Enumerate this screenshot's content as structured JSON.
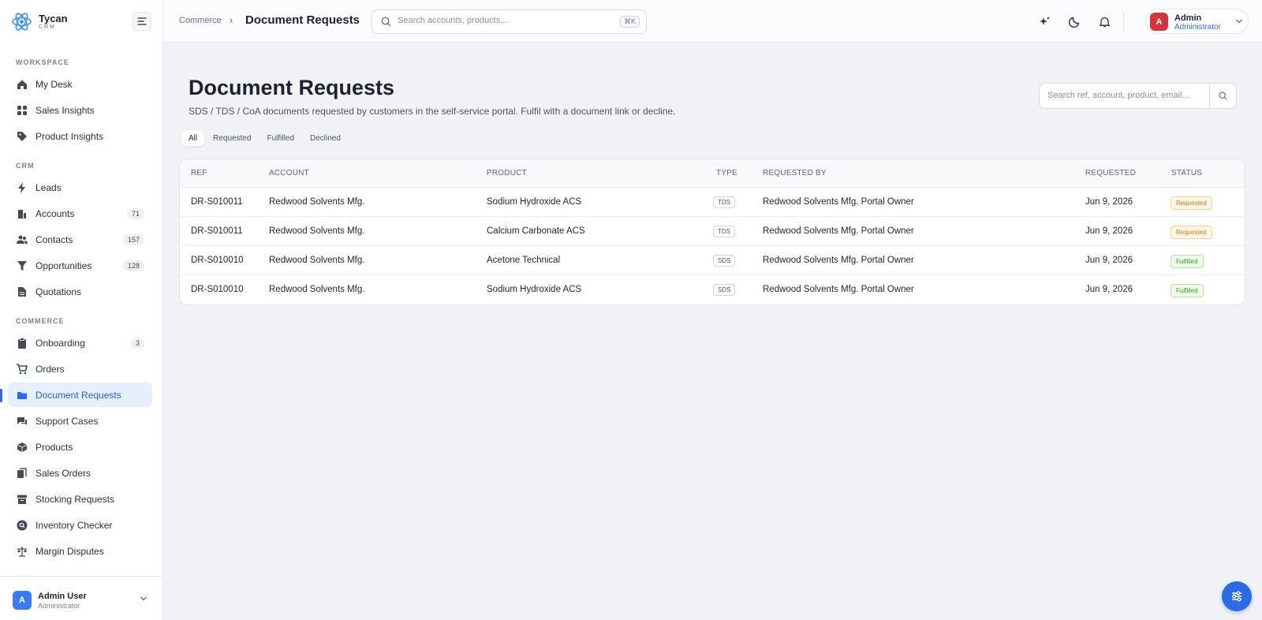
{
  "brand": {
    "name": "Tycan",
    "sub": "CRM"
  },
  "sidebar": {
    "sections": {
      "workspace": "WORKSPACE",
      "crm": "CRM",
      "commerce": "COMMERCE"
    },
    "items": [
      {
        "label": "My Desk",
        "icon": "home-icon"
      },
      {
        "label": "Sales Insights",
        "icon": "grid-icon"
      },
      {
        "label": "Product Insights",
        "icon": "tag-icon"
      },
      {
        "label": "Leads",
        "icon": "bolt-icon"
      },
      {
        "label": "Accounts",
        "icon": "building-icon",
        "count": "71"
      },
      {
        "label": "Contacts",
        "icon": "users-icon",
        "count": "157"
      },
      {
        "label": "Opportunities",
        "icon": "funnel-icon",
        "count": "128"
      },
      {
        "label": "Quotations",
        "icon": "file-icon"
      },
      {
        "label": "Onboarding",
        "icon": "clipboard-icon",
        "count": "3"
      },
      {
        "label": "Orders",
        "icon": "cart-icon"
      },
      {
        "label": "Document Requests",
        "icon": "folder-icon"
      },
      {
        "label": "Support Cases",
        "icon": "chat-icon"
      },
      {
        "label": "Products",
        "icon": "box-icon"
      },
      {
        "label": "Sales Orders",
        "icon": "copy-icon"
      },
      {
        "label": "Stocking Requests",
        "icon": "archive-icon"
      },
      {
        "label": "Inventory Checker",
        "icon": "search-circle-icon"
      },
      {
        "label": "Margin Disputes",
        "icon": "scale-icon"
      }
    ],
    "footer": {
      "avatar": "A",
      "name": "Admin User",
      "role": "Administrator"
    }
  },
  "topbar": {
    "breadcrumb": "Commerce",
    "separator": "›",
    "title": "Document Requests",
    "search_placeholder": "Search accounts, products...",
    "shortcut": "⌘K",
    "user": {
      "avatar": "A",
      "name": "Admin",
      "role": "Administrator"
    }
  },
  "main": {
    "title": "Document Requests",
    "subtitle": "SDS / TDS / CoA documents requested by customers in the self-service portal. Fulfil with a document link or decline.",
    "search_placeholder": "Search ref, account, product, email...",
    "tabs": [
      "All",
      "Requested",
      "Fulfilled",
      "Declined"
    ],
    "columns": [
      "REF",
      "ACCOUNT",
      "PRODUCT",
      "TYPE",
      "REQUESTED BY",
      "REQUESTED",
      "STATUS"
    ],
    "rows": [
      {
        "ref": "DR-S010011",
        "account": "Redwood Solvents Mfg.",
        "product": "Sodium Hydroxide ACS",
        "type": "TDS",
        "requested_by": "Redwood Solvents Mfg. Portal Owner",
        "requested": "Jun 9, 2026",
        "status": "Requested"
      },
      {
        "ref": "DR-S010011",
        "account": "Redwood Solvents Mfg.",
        "product": "Calcium Carbonate ACS",
        "type": "TDS",
        "requested_by": "Redwood Solvents Mfg. Portal Owner",
        "requested": "Jun 9, 2026",
        "status": "Requested"
      },
      {
        "ref": "DR-S010010",
        "account": "Redwood Solvents Mfg.",
        "product": "Acetone Technical",
        "type": "SDS",
        "requested_by": "Redwood Solvents Mfg. Portal Owner",
        "requested": "Jun 9, 2026",
        "status": "Fulfilled"
      },
      {
        "ref": "DR-S010010",
        "account": "Redwood Solvents Mfg.",
        "product": "Sodium Hydroxide ACS",
        "type": "SDS",
        "requested_by": "Redwood Solvents Mfg. Portal Owner",
        "requested": "Jun 9, 2026",
        "status": "Fulfilled"
      }
    ]
  },
  "colors": {
    "accent": "#2d6ae6",
    "requested": "#c77c16",
    "fulfilled": "#3f9a2a",
    "avatar_red": "#d5343b"
  }
}
